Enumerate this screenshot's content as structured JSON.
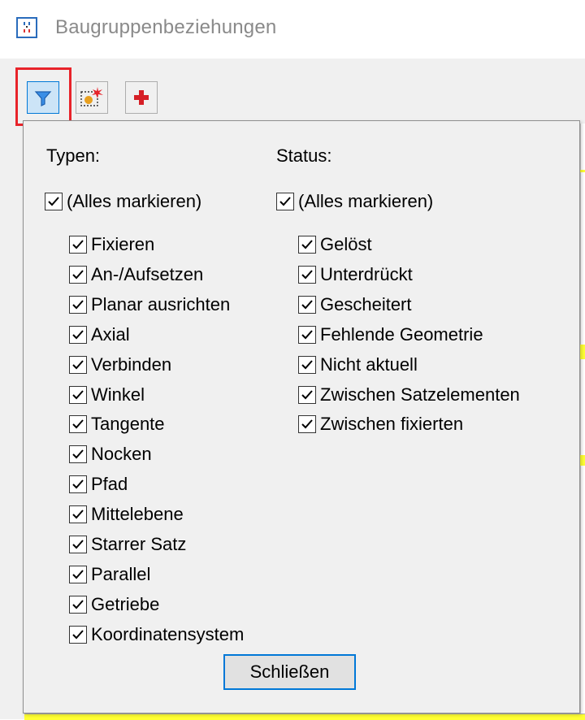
{
  "window": {
    "title": "Baugruppenbeziehungen"
  },
  "toolbar": {
    "buttons": [
      {
        "icon": "filter-icon",
        "active": true
      },
      {
        "icon": "highlight-select-icon"
      },
      {
        "icon": "add-relation-icon"
      }
    ],
    "highlight_color": "#e8232a",
    "active_color": "#cce4f7"
  },
  "filter_popup": {
    "types": {
      "label": "Typen:",
      "select_all": {
        "label": "(Alles markieren)",
        "checked": true
      },
      "items": [
        {
          "label": "Fixieren",
          "checked": true
        },
        {
          "label": "An-/Aufsetzen",
          "checked": true
        },
        {
          "label": "Planar ausrichten",
          "checked": true
        },
        {
          "label": "Axial",
          "checked": true
        },
        {
          "label": "Verbinden",
          "checked": true
        },
        {
          "label": "Winkel",
          "checked": true
        },
        {
          "label": "Tangente",
          "checked": true
        },
        {
          "label": "Nocken",
          "checked": true
        },
        {
          "label": "Pfad",
          "checked": true
        },
        {
          "label": "Mittelebene",
          "checked": true
        },
        {
          "label": "Starrer Satz",
          "checked": true
        },
        {
          "label": "Parallel",
          "checked": true
        },
        {
          "label": "Getriebe",
          "checked": true
        },
        {
          "label": "Koordinatensystem",
          "checked": true
        }
      ]
    },
    "status": {
      "label": "Status:",
      "select_all": {
        "label": "(Alles markieren)",
        "checked": true
      },
      "items": [
        {
          "label": "Gelöst",
          "checked": true
        },
        {
          "label": "Unterdrückt",
          "checked": true
        },
        {
          "label": "Gescheitert",
          "checked": true
        },
        {
          "label": "Fehlende Geometrie",
          "checked": true
        },
        {
          "label": "Nicht aktuell",
          "checked": true
        },
        {
          "label": "Zwischen Satzelementen",
          "checked": true
        },
        {
          "label": "Zwischen fixierten",
          "checked": true
        }
      ]
    },
    "close_label": "Schließen"
  }
}
